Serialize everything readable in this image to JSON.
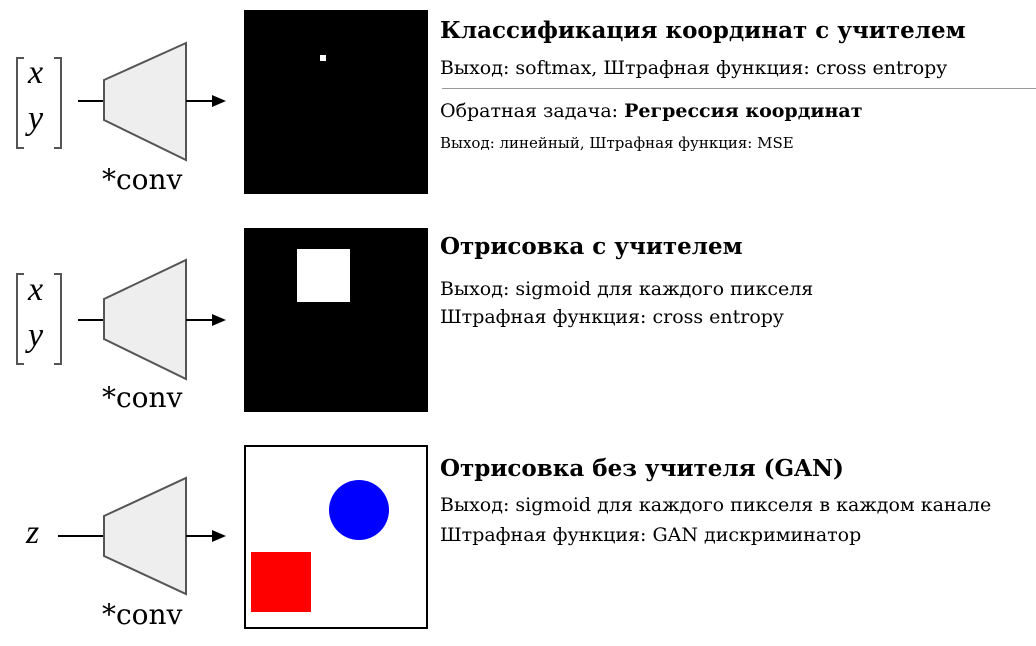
{
  "colors": {
    "canvas_dark": "#000000",
    "shape_white": "#ffffff",
    "circle": "#0000ff",
    "square": "#ff0000",
    "network": "#eeeeee"
  },
  "rows": [
    {
      "input_symbols": [
        "x",
        "y"
      ],
      "conv_label": "*conv",
      "title": "Классификация координат с учителем",
      "lines": [
        "Выход: softmax,   Штрафная функция: cross entropy"
      ],
      "inverse_prefix": "Обратная задача: ",
      "inverse_title": "Регрессия координат",
      "inverse_line": "Выход: линейный,    Штрафная функция: MSE"
    },
    {
      "input_symbols": [
        "x",
        "y"
      ],
      "conv_label": "*conv",
      "title": "Отрисовка с учителем",
      "lines": [
        "Выход: sigmoid для каждого пикселя",
        "Штрафная функция: cross entropy"
      ]
    },
    {
      "input_symbols": [
        "z"
      ],
      "conv_label": "*conv",
      "title": "Отрисовка без учителя (GAN)",
      "lines": [
        "Выход: sigmoid для каждого пикселя в каждом канале",
        "Штрафная функция: GAN дискриминатор"
      ]
    }
  ]
}
